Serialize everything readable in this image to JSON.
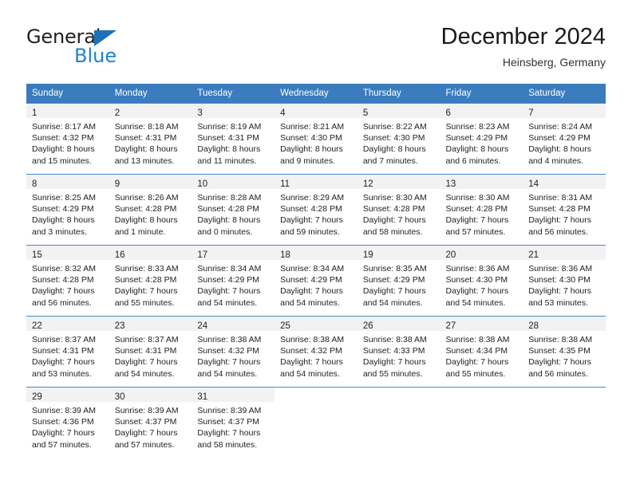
{
  "brand": {
    "name_top": "General",
    "name_bottom": "Blue",
    "triangle_icon": "triangle-icon",
    "color_dark": "#231f20",
    "color_blue": "#2083c8"
  },
  "header": {
    "title": "December 2024",
    "subtitle": "Heinsberg, Germany"
  },
  "theme": {
    "header_bg": "#3a7cbe",
    "row_separator": "#4a86c4",
    "daynum_band_bg": "#f2f2f2",
    "text": "#222222"
  },
  "weekdays": [
    "Sunday",
    "Monday",
    "Tuesday",
    "Wednesday",
    "Thursday",
    "Friday",
    "Saturday"
  ],
  "weeks": [
    [
      {
        "day": "1",
        "sunrise": "Sunrise: 8:17 AM",
        "sunset": "Sunset: 4:32 PM",
        "daylight1": "Daylight: 8 hours",
        "daylight2": "and 15 minutes."
      },
      {
        "day": "2",
        "sunrise": "Sunrise: 8:18 AM",
        "sunset": "Sunset: 4:31 PM",
        "daylight1": "Daylight: 8 hours",
        "daylight2": "and 13 minutes."
      },
      {
        "day": "3",
        "sunrise": "Sunrise: 8:19 AM",
        "sunset": "Sunset: 4:31 PM",
        "daylight1": "Daylight: 8 hours",
        "daylight2": "and 11 minutes."
      },
      {
        "day": "4",
        "sunrise": "Sunrise: 8:21 AM",
        "sunset": "Sunset: 4:30 PM",
        "daylight1": "Daylight: 8 hours",
        "daylight2": "and 9 minutes."
      },
      {
        "day": "5",
        "sunrise": "Sunrise: 8:22 AM",
        "sunset": "Sunset: 4:30 PM",
        "daylight1": "Daylight: 8 hours",
        "daylight2": "and 7 minutes."
      },
      {
        "day": "6",
        "sunrise": "Sunrise: 8:23 AM",
        "sunset": "Sunset: 4:29 PM",
        "daylight1": "Daylight: 8 hours",
        "daylight2": "and 6 minutes."
      },
      {
        "day": "7",
        "sunrise": "Sunrise: 8:24 AM",
        "sunset": "Sunset: 4:29 PM",
        "daylight1": "Daylight: 8 hours",
        "daylight2": "and 4 minutes."
      }
    ],
    [
      {
        "day": "8",
        "sunrise": "Sunrise: 8:25 AM",
        "sunset": "Sunset: 4:29 PM",
        "daylight1": "Daylight: 8 hours",
        "daylight2": "and 3 minutes."
      },
      {
        "day": "9",
        "sunrise": "Sunrise: 8:26 AM",
        "sunset": "Sunset: 4:28 PM",
        "daylight1": "Daylight: 8 hours",
        "daylight2": "and 1 minute."
      },
      {
        "day": "10",
        "sunrise": "Sunrise: 8:28 AM",
        "sunset": "Sunset: 4:28 PM",
        "daylight1": "Daylight: 8 hours",
        "daylight2": "and 0 minutes."
      },
      {
        "day": "11",
        "sunrise": "Sunrise: 8:29 AM",
        "sunset": "Sunset: 4:28 PM",
        "daylight1": "Daylight: 7 hours",
        "daylight2": "and 59 minutes."
      },
      {
        "day": "12",
        "sunrise": "Sunrise: 8:30 AM",
        "sunset": "Sunset: 4:28 PM",
        "daylight1": "Daylight: 7 hours",
        "daylight2": "and 58 minutes."
      },
      {
        "day": "13",
        "sunrise": "Sunrise: 8:30 AM",
        "sunset": "Sunset: 4:28 PM",
        "daylight1": "Daylight: 7 hours",
        "daylight2": "and 57 minutes."
      },
      {
        "day": "14",
        "sunrise": "Sunrise: 8:31 AM",
        "sunset": "Sunset: 4:28 PM",
        "daylight1": "Daylight: 7 hours",
        "daylight2": "and 56 minutes."
      }
    ],
    [
      {
        "day": "15",
        "sunrise": "Sunrise: 8:32 AM",
        "sunset": "Sunset: 4:28 PM",
        "daylight1": "Daylight: 7 hours",
        "daylight2": "and 56 minutes."
      },
      {
        "day": "16",
        "sunrise": "Sunrise: 8:33 AM",
        "sunset": "Sunset: 4:28 PM",
        "daylight1": "Daylight: 7 hours",
        "daylight2": "and 55 minutes."
      },
      {
        "day": "17",
        "sunrise": "Sunrise: 8:34 AM",
        "sunset": "Sunset: 4:29 PM",
        "daylight1": "Daylight: 7 hours",
        "daylight2": "and 54 minutes."
      },
      {
        "day": "18",
        "sunrise": "Sunrise: 8:34 AM",
        "sunset": "Sunset: 4:29 PM",
        "daylight1": "Daylight: 7 hours",
        "daylight2": "and 54 minutes."
      },
      {
        "day": "19",
        "sunrise": "Sunrise: 8:35 AM",
        "sunset": "Sunset: 4:29 PM",
        "daylight1": "Daylight: 7 hours",
        "daylight2": "and 54 minutes."
      },
      {
        "day": "20",
        "sunrise": "Sunrise: 8:36 AM",
        "sunset": "Sunset: 4:30 PM",
        "daylight1": "Daylight: 7 hours",
        "daylight2": "and 54 minutes."
      },
      {
        "day": "21",
        "sunrise": "Sunrise: 8:36 AM",
        "sunset": "Sunset: 4:30 PM",
        "daylight1": "Daylight: 7 hours",
        "daylight2": "and 53 minutes."
      }
    ],
    [
      {
        "day": "22",
        "sunrise": "Sunrise: 8:37 AM",
        "sunset": "Sunset: 4:31 PM",
        "daylight1": "Daylight: 7 hours",
        "daylight2": "and 53 minutes."
      },
      {
        "day": "23",
        "sunrise": "Sunrise: 8:37 AM",
        "sunset": "Sunset: 4:31 PM",
        "daylight1": "Daylight: 7 hours",
        "daylight2": "and 54 minutes."
      },
      {
        "day": "24",
        "sunrise": "Sunrise: 8:38 AM",
        "sunset": "Sunset: 4:32 PM",
        "daylight1": "Daylight: 7 hours",
        "daylight2": "and 54 minutes."
      },
      {
        "day": "25",
        "sunrise": "Sunrise: 8:38 AM",
        "sunset": "Sunset: 4:32 PM",
        "daylight1": "Daylight: 7 hours",
        "daylight2": "and 54 minutes."
      },
      {
        "day": "26",
        "sunrise": "Sunrise: 8:38 AM",
        "sunset": "Sunset: 4:33 PM",
        "daylight1": "Daylight: 7 hours",
        "daylight2": "and 55 minutes."
      },
      {
        "day": "27",
        "sunrise": "Sunrise: 8:38 AM",
        "sunset": "Sunset: 4:34 PM",
        "daylight1": "Daylight: 7 hours",
        "daylight2": "and 55 minutes."
      },
      {
        "day": "28",
        "sunrise": "Sunrise: 8:38 AM",
        "sunset": "Sunset: 4:35 PM",
        "daylight1": "Daylight: 7 hours",
        "daylight2": "and 56 minutes."
      }
    ],
    [
      {
        "day": "29",
        "sunrise": "Sunrise: 8:39 AM",
        "sunset": "Sunset: 4:36 PM",
        "daylight1": "Daylight: 7 hours",
        "daylight2": "and 57 minutes."
      },
      {
        "day": "30",
        "sunrise": "Sunrise: 8:39 AM",
        "sunset": "Sunset: 4:37 PM",
        "daylight1": "Daylight: 7 hours",
        "daylight2": "and 57 minutes."
      },
      {
        "day": "31",
        "sunrise": "Sunrise: 8:39 AM",
        "sunset": "Sunset: 4:37 PM",
        "daylight1": "Daylight: 7 hours",
        "daylight2": "and 58 minutes."
      },
      {
        "day": "",
        "sunrise": "",
        "sunset": "",
        "daylight1": "",
        "daylight2": ""
      },
      {
        "day": "",
        "sunrise": "",
        "sunset": "",
        "daylight1": "",
        "daylight2": ""
      },
      {
        "day": "",
        "sunrise": "",
        "sunset": "",
        "daylight1": "",
        "daylight2": ""
      },
      {
        "day": "",
        "sunrise": "",
        "sunset": "",
        "daylight1": "",
        "daylight2": ""
      }
    ]
  ]
}
